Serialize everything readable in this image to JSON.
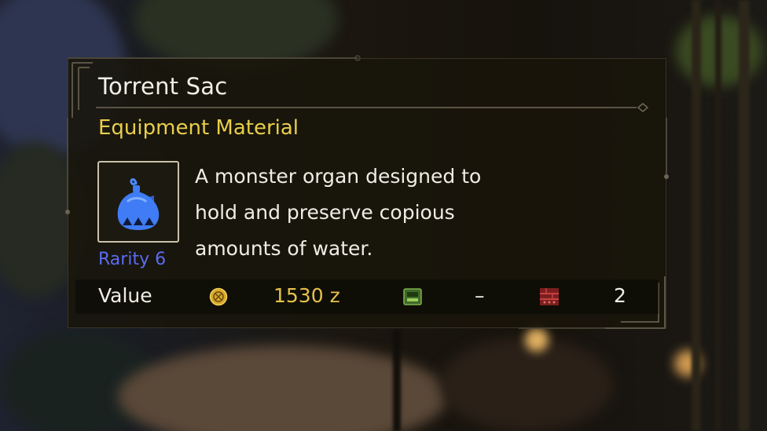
{
  "item": {
    "name": "Torrent Sac",
    "category": "Equipment Material",
    "rarity": "Rarity 6",
    "description_lines": [
      "A monster organ designed to",
      "hold and preserve copious",
      "amounts of water."
    ],
    "icon": "torrent-sac-icon"
  },
  "value_row": {
    "label": "Value",
    "price_icon": "zenny-coin-icon",
    "price": "1530 z",
    "storage_icon": "item-pouch-icon",
    "storage_value": "–",
    "box_icon": "item-box-icon",
    "box_value": "2"
  },
  "colors": {
    "title": "#f2efe6",
    "category": "#e9cf4a",
    "rarity": "#5a6cf2",
    "price": "#e6c24a",
    "icon_blue": "#3f7cf5"
  }
}
